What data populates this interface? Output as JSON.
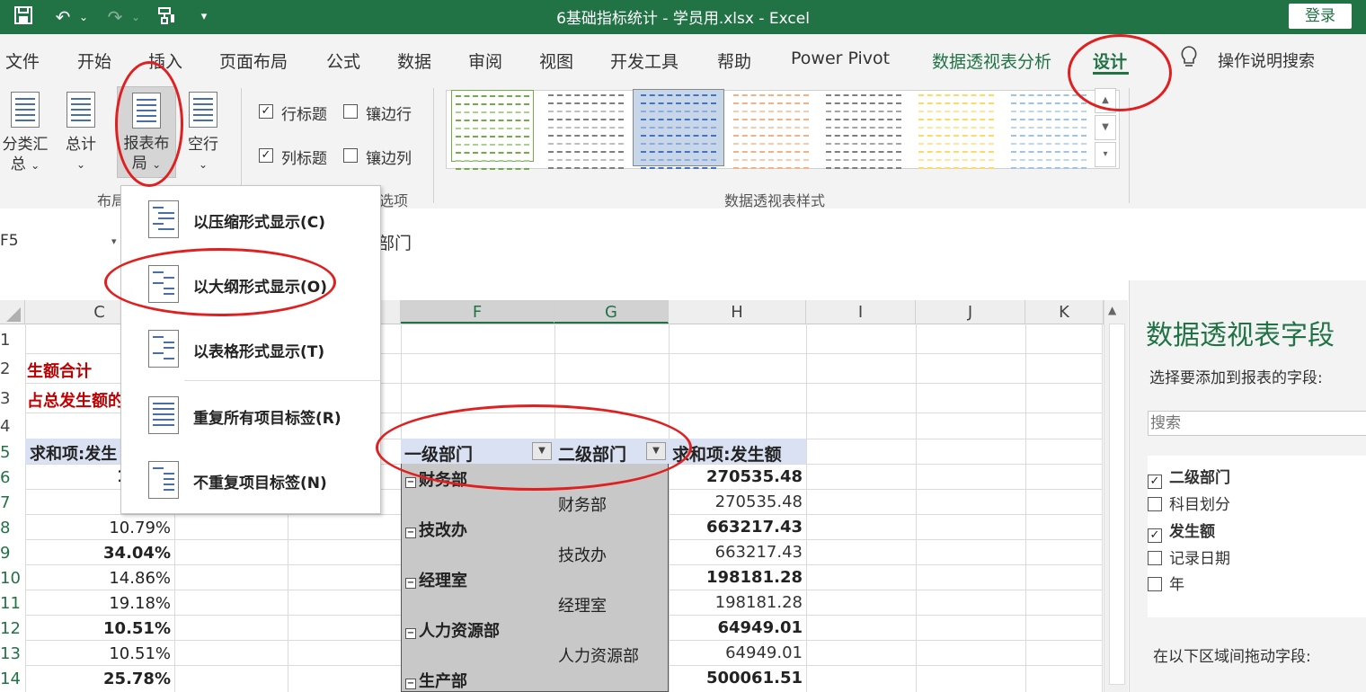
{
  "window": {
    "title": "6基础指标统计 - 学员用.xlsx  -  Excel",
    "login": "登录",
    "qat": [
      "save-icon",
      "undo-icon",
      "redo-icon",
      "format-painter-icon",
      "customize-icon"
    ]
  },
  "tabs": [
    "文件",
    "开始",
    "插入",
    "页面布局",
    "公式",
    "数据",
    "审阅",
    "视图",
    "开发工具",
    "帮助",
    "Power Pivot",
    "数据透视表分析",
    "设计"
  ],
  "tell_me": "操作说明搜索",
  "ribbon": {
    "layout": {
      "subtotals": [
        "分类汇",
        "总"
      ],
      "grand_totals": "总计",
      "report_layout": [
        "报表布",
        "局"
      ],
      "blank_rows": "空行",
      "group_label": "布局"
    },
    "options": {
      "row_headers": "行标题",
      "banded_rows": "镶边行",
      "col_headers": "列标题",
      "banded_cols": "镶边列",
      "group_label": "选项"
    },
    "styles": {
      "group_label": "数据透视表样式",
      "accent_colors": [
        "#70ad47",
        "#7f7f7f",
        "#4472c4",
        "#f4b183",
        "#7f7f7f",
        "#ffd966",
        "#9dc3e6"
      ]
    }
  },
  "report_layout_menu": [
    "以压缩形式显示(C)",
    "以大纲形式显示(O)",
    "以表格形式显示(T)",
    "重复所有项目标签(R)",
    "不重复项目标签(N)"
  ],
  "formula_bar": {
    "name_box": "F5",
    "value": "部门"
  },
  "columns": [
    "C",
    "F",
    "G",
    "H",
    "I",
    "J",
    "K"
  ],
  "rows": [
    "1",
    "2",
    "3",
    "4",
    "5",
    "6",
    "7",
    "8",
    "9",
    "10",
    "11",
    "12",
    "13",
    "14"
  ],
  "col_c": {
    "row2": "生额合计",
    "row3": "占总发生额的",
    "row5": "求和项:发生",
    "row6": "1",
    "percents": [
      "10.79%",
      "34.04%",
      "14.86%",
      "19.18%",
      "10.51%",
      "10.51%",
      "25.78%"
    ]
  },
  "pivot": {
    "headers": [
      "一级部门",
      "二级部门",
      "求和项:发生额"
    ],
    "rows": [
      {
        "l1": "财务部",
        "l2": "财务部",
        "total": "270535.48",
        "value": "270535.48"
      },
      {
        "l1": "技改办",
        "l2": "技改办",
        "total": "663217.43",
        "value": "663217.43"
      },
      {
        "l1": "经理室",
        "l2": "经理室",
        "total": "198181.28",
        "value": "198181.28"
      },
      {
        "l1": "人力资源部",
        "l2": "人力资源部",
        "total": "64949.01",
        "value": "64949.01"
      },
      {
        "l1": "生产部",
        "total": "500061.51"
      }
    ]
  },
  "field_pane": {
    "title": "数据透视表字段",
    "subtitle": "选择要添加到报表的字段:",
    "search_placeholder": "搜索",
    "fields": [
      {
        "name": "二级部门",
        "checked": true
      },
      {
        "name": "科目划分",
        "checked": false
      },
      {
        "name": "发生额",
        "checked": true
      },
      {
        "name": "记录日期",
        "checked": false
      },
      {
        "name": "年",
        "checked": false
      }
    ],
    "drag_label": "在以下区域间拖动字段:"
  }
}
